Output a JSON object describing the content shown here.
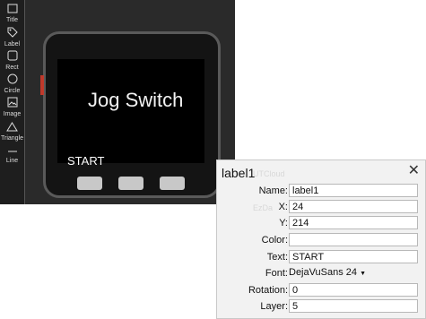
{
  "toolbar": {
    "tools": [
      {
        "label": "Title",
        "icon": "title-icon"
      },
      {
        "label": "Label",
        "icon": "tag-icon"
      },
      {
        "label": "Rect",
        "icon": "rect-icon"
      },
      {
        "label": "Circle",
        "icon": "circle-icon"
      },
      {
        "label": "Image",
        "icon": "image-icon"
      },
      {
        "label": "Triangle",
        "icon": "triangle-icon"
      },
      {
        "label": "Line",
        "icon": "line-icon"
      }
    ]
  },
  "device": {
    "screen_title": "Jog Switch",
    "start_label": "START"
  },
  "panel": {
    "title": "label1",
    "close_symbol": "✕",
    "fields": {
      "name": {
        "label": "Name:",
        "value": "label1"
      },
      "x": {
        "label": "X:",
        "value": "24"
      },
      "y": {
        "label": "Y:",
        "value": "214"
      },
      "color": {
        "label": "Color:",
        "value": ""
      },
      "text": {
        "label": "Text:",
        "value": "START"
      },
      "font": {
        "label": "Font:",
        "value": "DejaVuSans 24"
      },
      "rotation": {
        "label": "Rotation:",
        "value": "0"
      },
      "layer": {
        "label": "Layer:",
        "value": "5"
      }
    },
    "ghost_text": [
      "UTCloud",
      "EzDa"
    ]
  },
  "colors": {
    "canvas_bg": "#2a2a2a",
    "screen_bg": "#000000",
    "accent": "#c0392b",
    "panel_bg": "#f2f2f2"
  }
}
